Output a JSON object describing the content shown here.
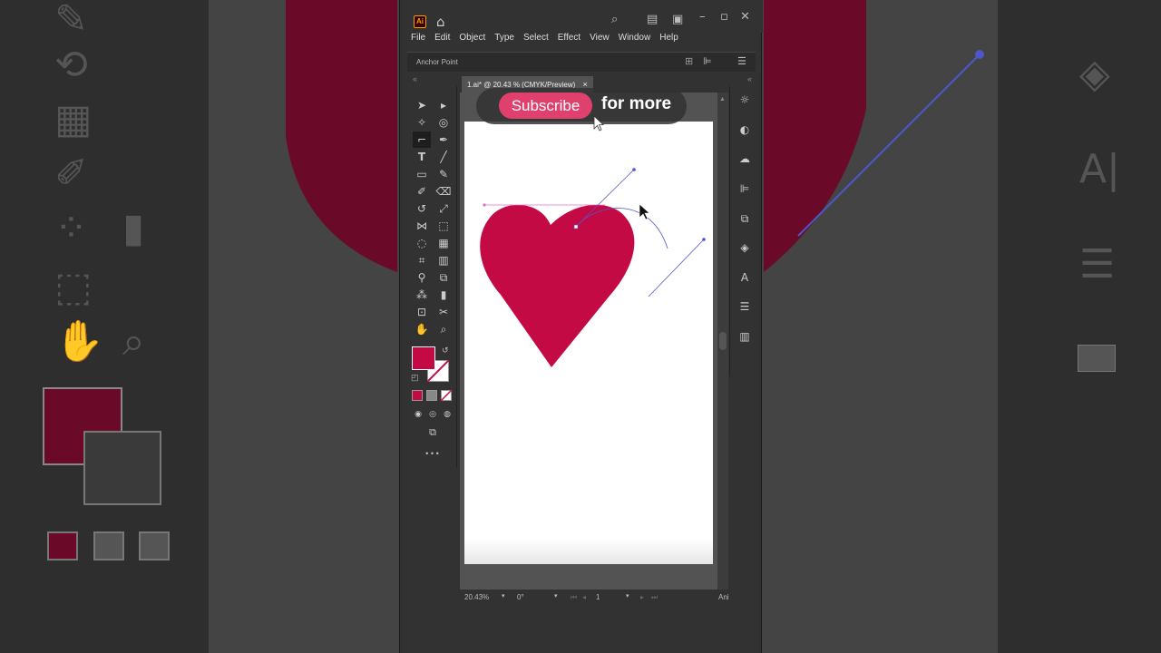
{
  "titlebar": {
    "app_icon": "Ai",
    "icons": [
      "home-icon",
      "search-icon",
      "arrange-docs-icon",
      "workspace-icon",
      "minimize-icon",
      "maximize-icon",
      "close-icon"
    ]
  },
  "menu": [
    "File",
    "Edit",
    "Object",
    "Type",
    "Select",
    "Effect",
    "View",
    "Window",
    "Help"
  ],
  "control_bar": {
    "label": "Anchor Point"
  },
  "document": {
    "tab_title": "1.ai* @ 20.43 % (CMYK/Preview)",
    "tab_close": "×"
  },
  "overlay": {
    "subscribe_label": "Subscribe",
    "for_more": "for more"
  },
  "status": {
    "zoom": "20.43%",
    "rotate": "0°",
    "artboard": "1",
    "right_text": "Ani"
  },
  "colors": {
    "heart": "#c40a45",
    "path": "#4e57c7",
    "subscribe": "#e0406e"
  },
  "more_tools": "•••"
}
